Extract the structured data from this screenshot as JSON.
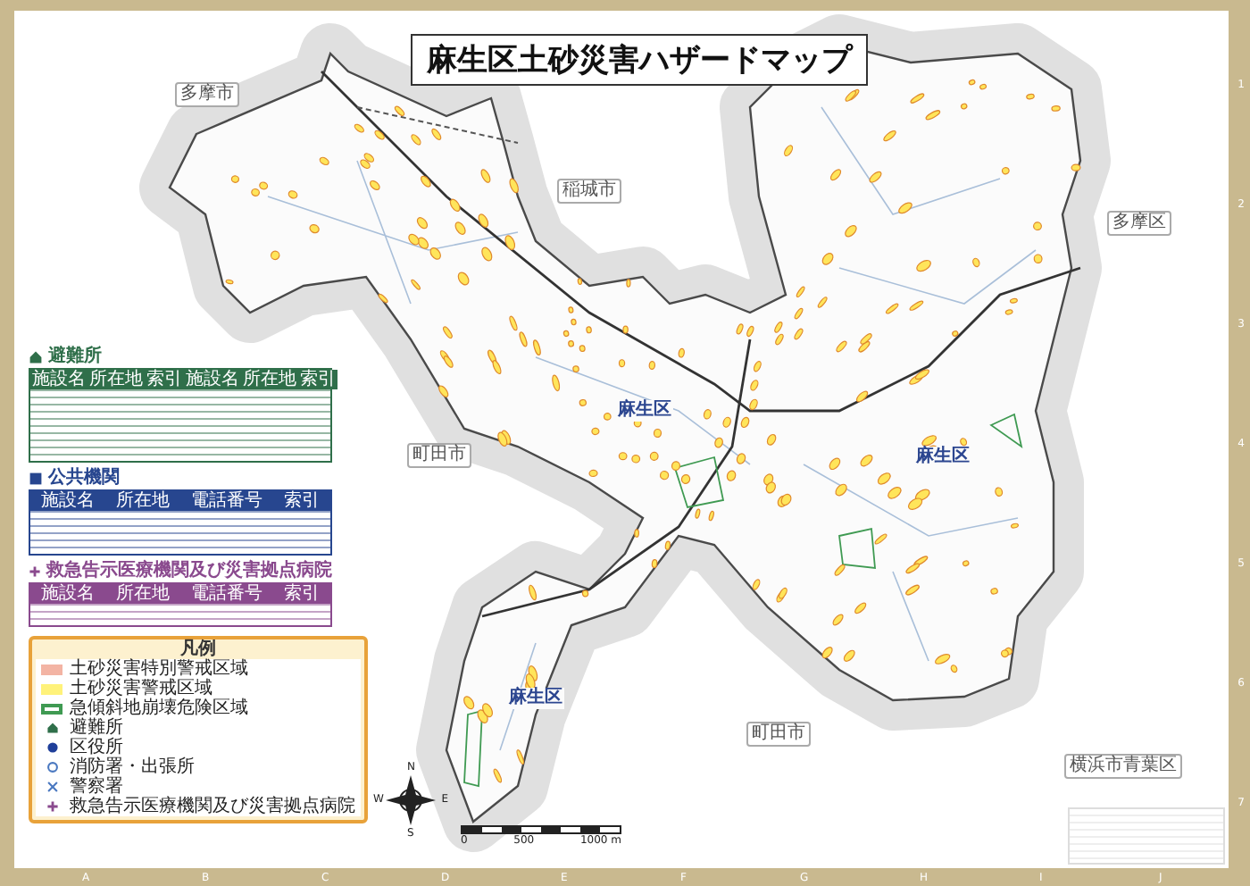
{
  "title": "麻生区土砂災害ハザードマップ",
  "place_labels": [
    {
      "text": "多摩市",
      "kind": "city"
    },
    {
      "text": "稲城市",
      "kind": "city"
    },
    {
      "text": "多摩区",
      "kind": "city"
    },
    {
      "text": "町田市",
      "kind": "city"
    },
    {
      "text": "町田市",
      "kind": "city"
    },
    {
      "text": "横浜市青葉区",
      "kind": "city"
    },
    {
      "text": "麻生区",
      "kind": "ward"
    },
    {
      "text": "麻生区",
      "kind": "ward"
    },
    {
      "text": "麻生区",
      "kind": "ward"
    }
  ],
  "facility_tables": [
    {
      "heading": "避難所",
      "color": "#2f6f4a",
      "columns": [
        "施設名",
        "所在地",
        "索引",
        "施設名",
        "所在地",
        "索引"
      ]
    },
    {
      "heading": "公共機関",
      "color": "#27468f",
      "columns": [
        "施設名",
        "所在地",
        "電話番号",
        "索引"
      ]
    },
    {
      "heading": "救急告示医療機関及び災害拠点病院",
      "color": "#8a4a8e",
      "columns": [
        "施設名",
        "所在地",
        "電話番号",
        "索引"
      ]
    }
  ],
  "legend": {
    "title": "凡例",
    "items": [
      {
        "kind": "area",
        "color": "#f3b4a4",
        "label": "土砂災害特別警戒区域"
      },
      {
        "kind": "area",
        "color": "#fff27a",
        "label": "土砂災害警戒区域"
      },
      {
        "kind": "outline",
        "color": "#3f9a52",
        "label": "急傾斜地崩壊危険区域"
      },
      {
        "kind": "house",
        "color": "#2f6f4a",
        "label": "避難所"
      },
      {
        "kind": "dot",
        "color": "#1f3f9a",
        "label": "区役所"
      },
      {
        "kind": "ring",
        "color": "#4a78c0",
        "label": "消防署・出張所"
      },
      {
        "kind": "cross",
        "color": "#4a78c0",
        "label": "警察署"
      },
      {
        "kind": "plus",
        "color": "#8a4a8e",
        "label": "救急告示医療機関及び災害拠点病院"
      }
    ]
  },
  "compass": {
    "letters": [
      "N",
      "E",
      "S",
      "W"
    ]
  },
  "scale": {
    "labels": [
      "0",
      "500",
      "1000 m"
    ]
  },
  "grid": {
    "columns": [
      "A",
      "B",
      "C",
      "D",
      "E",
      "F",
      "G",
      "H",
      "I",
      "J"
    ],
    "rows": [
      "1",
      "2",
      "3",
      "4",
      "5",
      "6",
      "7"
    ]
  }
}
